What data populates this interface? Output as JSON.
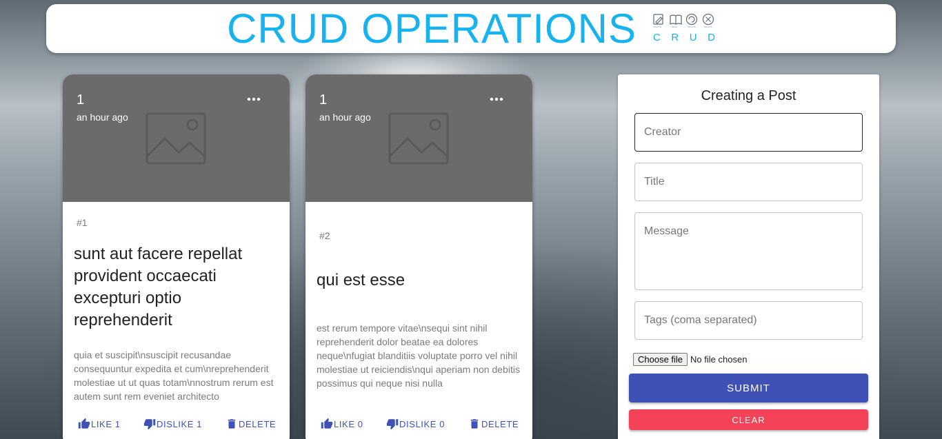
{
  "header": {
    "title": "CRUD OPERATIONS",
    "logo": {
      "letters": [
        "C",
        "R",
        "U",
        "D"
      ],
      "icons": [
        "pencil-icon",
        "book-icon",
        "refresh-icon",
        "close-circle-icon"
      ]
    }
  },
  "posts": [
    {
      "creator": "1",
      "time": "an hour ago",
      "tags": "#1",
      "title": "sunt aut facere repellat provident occaecati excepturi optio reprehenderit",
      "message": "quia et suscipit\\nsuscipit recusandae consequuntur expedita et cum\\nreprehenderit molestiae ut ut quas totam\\nnostrum rerum est autem sunt rem eveniet architecto",
      "like_label": "LIKE 1",
      "dislike_label": "DISLIKE 1",
      "delete_label": "DELETE"
    },
    {
      "creator": "1",
      "time": "an hour ago",
      "tags": "#2",
      "title": "qui est esse",
      "message": "est rerum tempore vitae\\nsequi sint nihil reprehenderit dolor beatae ea dolores neque\\nfugiat blanditiis voluptate porro vel nihil molestiae ut reiciendis\\nqui aperiam non debitis possimus qui neque nisi nulla",
      "like_label": "LIKE 0",
      "dislike_label": "DISLIKE 0",
      "delete_label": "DELETE"
    }
  ],
  "form": {
    "title": "Creating a Post",
    "creator_placeholder": "Creator",
    "title_placeholder": "Title",
    "message_placeholder": "Message",
    "tags_placeholder": "Tags (coma separated)",
    "file_button": "Choose file",
    "file_status": "No file chosen",
    "submit_label": "SUBMIT",
    "clear_label": "CLEAR"
  },
  "colors": {
    "accent_title": "#17b2ef",
    "primary": "#3f51b5",
    "danger": "#f44258",
    "media_bg": "#6b6b6b"
  }
}
